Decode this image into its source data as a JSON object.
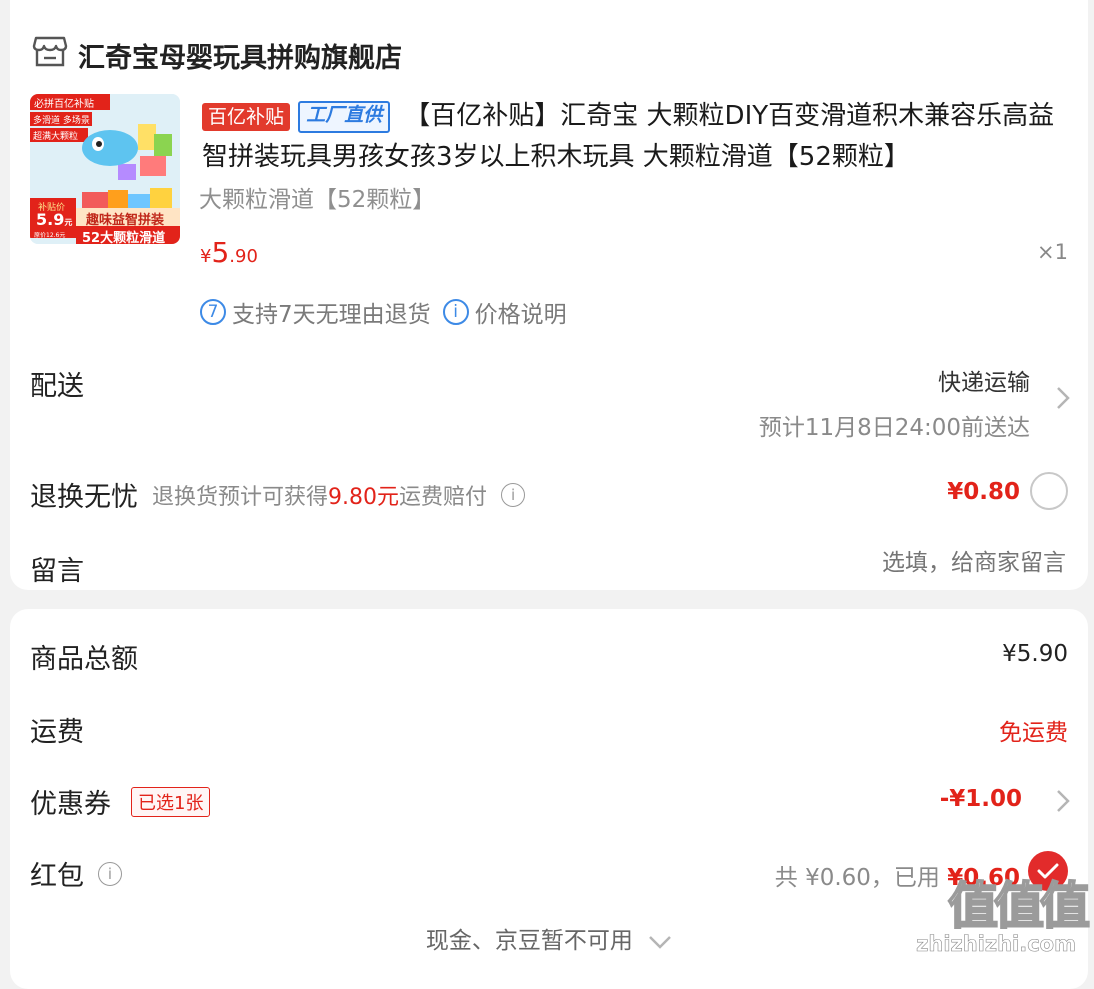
{
  "store": {
    "name": "汇奇宝母婴玩具拼购旗舰店",
    "icon": "store-icon"
  },
  "product": {
    "thumbnail": {
      "badge_top": "必拼百亿补贴",
      "tag1": "多滑道",
      "tag2": "多场景",
      "tag3": "超满大颗粒",
      "subsidy_label": "补贴价",
      "subsidy_price": "5.9",
      "subsidy_unit": "元",
      "subsidy_note": "原价12.6元",
      "banner1": "趣味益智拼装",
      "banner2": "52大颗粒滑道"
    },
    "tag_subsidy": "百亿补贴",
    "tag_factory": "工厂直供",
    "title": "【百亿补贴】汇奇宝 大颗粒DIY百变滑道积木兼容乐高益智拼装玩具男孩女孩3岁以上积木玩具 大颗粒滑道【52颗粒】",
    "sku": "大颗粒滑道【52颗粒】",
    "price_currency": "¥",
    "price_int": "5",
    "price_dec": ".90",
    "quantity": "×1"
  },
  "services": {
    "return_badge": "7",
    "return_text": "支持7天无理由退货",
    "price_info_icon": "i",
    "price_info_text": "价格说明"
  },
  "delivery": {
    "label": "配送",
    "method": "快递运输",
    "eta": "预计11月8日24:00前送达"
  },
  "return_insurance": {
    "label": "退换无忧",
    "desc_prefix": "退换货预计可获得",
    "desc_amount": "9.80元",
    "desc_suffix": "运费赔付",
    "price": "¥0.80"
  },
  "note": {
    "label": "留言",
    "placeholder": "选填，给商家留言"
  },
  "summary": {
    "total_label": "商品总额",
    "total_value": "¥5.90",
    "shipping_label": "运费",
    "shipping_value": "免运费",
    "coupon_label": "优惠券",
    "coupon_badge": "已选1张",
    "coupon_value": "-¥1.00",
    "redpacket_label": "红包",
    "redpacket_total": "共 ¥0.60，已用 ",
    "redpacket_used": "¥0.60",
    "cash_note": "现金、京豆暂不可用"
  },
  "watermark": {
    "chars": "值值值",
    "url": "zhizhizhi.com"
  },
  "colors": {
    "accent": "#e2231a",
    "blue": "#2d7be0",
    "bg": "#f2f2f2"
  }
}
